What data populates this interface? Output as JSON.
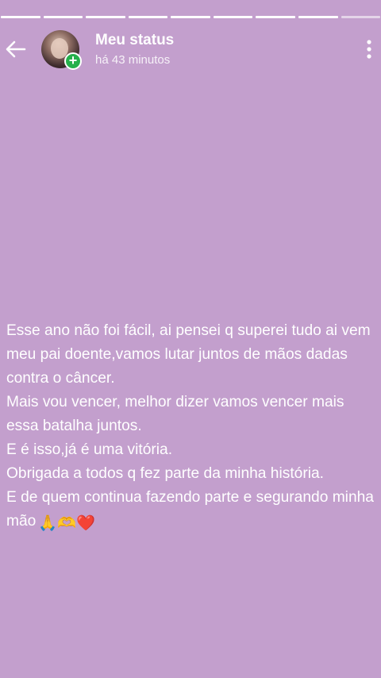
{
  "status_header": {
    "title": "Meu status",
    "time": "há 43 minutos"
  },
  "progress_segments": 9,
  "icons": {
    "back": "arrow-left-icon",
    "menu": "more-vertical-icon",
    "add": "plus-icon"
  },
  "status_body": {
    "text": "Esse ano não foi fácil, ai pensei q superei tudo ai vem meu pai doente,vamos lutar juntos de mãos dadas contra o câncer.\nMais vou vencer, melhor dizer vamos vencer mais essa batalha juntos.\nE é isso,já é uma vitória.\nObrigada a todos q fez parte da minha história.\nE de quem continua fazendo parte e segurando minha mão",
    "emojis": "🙏🫶❤️"
  },
  "colors": {
    "background": "#c39fcd",
    "add_badge": "#25b04c"
  }
}
